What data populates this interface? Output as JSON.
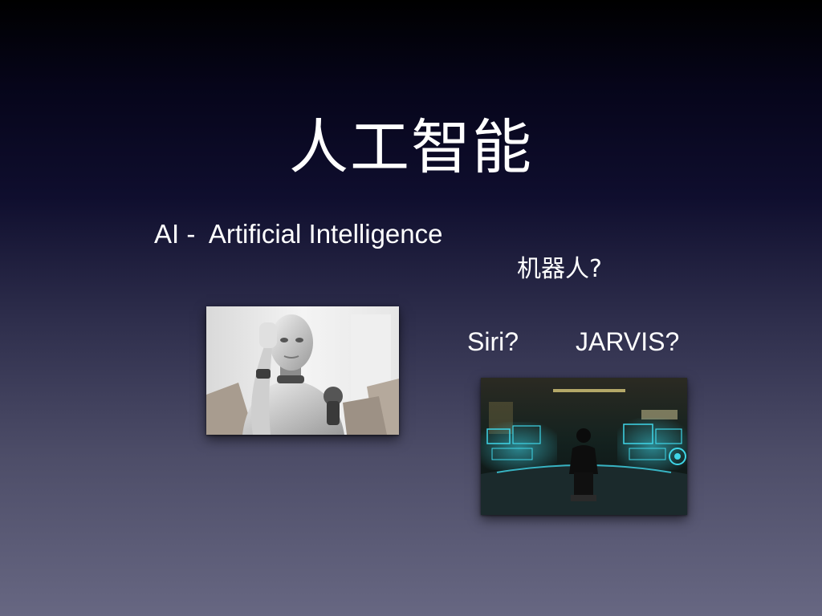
{
  "slide": {
    "title": "人工智能",
    "subtitle": "AI -  Artificial Intelligence",
    "question_robot": "机器人?",
    "question_siri": "Siri?",
    "question_jarvis": "JARVIS?"
  },
  "images": [
    {
      "name": "robot-photo",
      "icon": "humanoid-robot"
    },
    {
      "name": "jarvis-photo",
      "icon": "holographic-control-room"
    }
  ],
  "colors": {
    "background_top": "#000000",
    "background_bottom": "#676782",
    "text": "#ffffff",
    "hologram_cyan": "#3fd6e8"
  }
}
